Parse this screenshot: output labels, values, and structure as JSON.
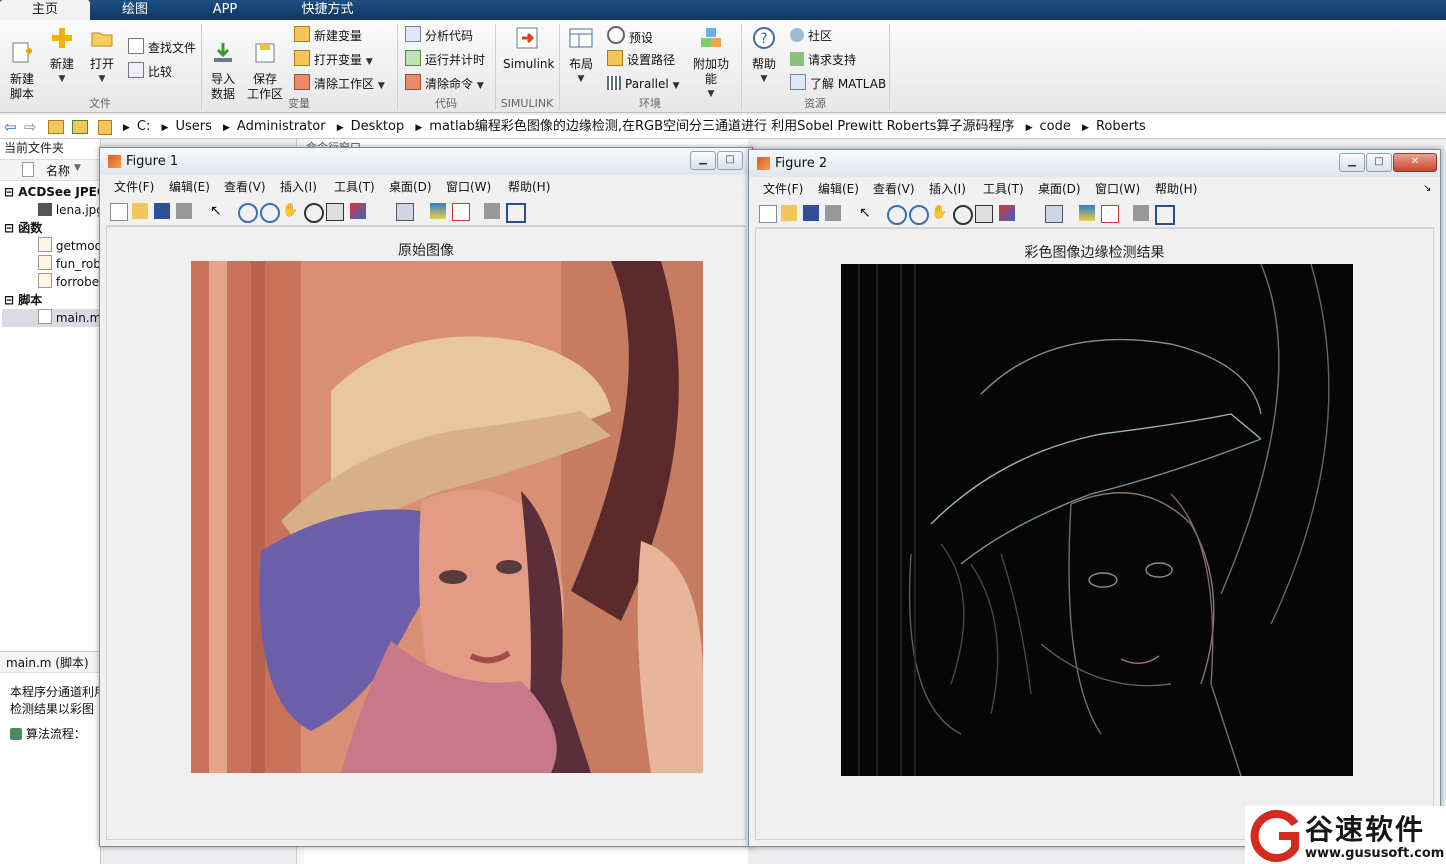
{
  "tabs": [
    {
      "label": "主页"
    },
    {
      "label": "绘图"
    },
    {
      "label": "APP"
    },
    {
      "label": "快捷方式"
    }
  ],
  "ribbon": {
    "file": {
      "new_script": "新建\n脚本",
      "new": "新建",
      "open": "打开",
      "find_files": "查找文件",
      "compare": "比较",
      "group": "文件"
    },
    "variable": {
      "import": "导入\n数据",
      "save_ws": "保存\n工作区",
      "new_var": "新建变量",
      "open_var": "打开变量",
      "clear_ws": "清除工作区",
      "group": "变量"
    },
    "code": {
      "analyze": "分析代码",
      "run_time": "运行并计时",
      "clear_cmd": "清除命令",
      "group": "代码"
    },
    "simulink": {
      "label": "Simulink",
      "group": "SIMULINK"
    },
    "env": {
      "layout": "布局",
      "prefs": "预设",
      "set_path": "设置路径",
      "parallel": "Parallel",
      "addons": "附加功能",
      "group": "环境"
    },
    "resources": {
      "help": "帮助",
      "community": "社区",
      "support": "请求支持",
      "learn": "了解 MATLAB",
      "group": "资源"
    }
  },
  "address": {
    "crumbs": [
      "C:",
      "Users",
      "Administrator",
      "Desktop",
      "matlab编程彩色图像的边缘检测,在RGB空间分三通道进行 利用Sobel Prewitt  Roberts算子源码程序",
      "code",
      "Roberts"
    ]
  },
  "left_panel": {
    "title": "当前文件夹",
    "name_col": "名称",
    "items": [
      {
        "label": "ACDSee JPEG",
        "kind": "group"
      },
      {
        "label": "lena.jpg",
        "kind": "file"
      },
      {
        "label": "函数",
        "kind": "group"
      },
      {
        "label": "getmod",
        "kind": "file"
      },
      {
        "label": "fun_rob",
        "kind": "file"
      },
      {
        "label": "forrobe",
        "kind": "file"
      },
      {
        "label": "脚本",
        "kind": "group"
      },
      {
        "label": "main.m",
        "kind": "file"
      }
    ],
    "detail_title": "main.m  (脚本)",
    "detail_line1": "本程序分通道利用",
    "detail_line2": "检测结果以彩图",
    "detail_line3": "算法流程：",
    "cmd_title": "命令行窗口"
  },
  "menus": [
    "文件(F)",
    "编辑(E)",
    "查看(V)",
    "插入(I)",
    "工具(T)",
    "桌面(D)",
    "窗口(W)",
    "帮助(H)"
  ],
  "figure1": {
    "title": "Figure 1",
    "plot_title": "原始图像"
  },
  "figure2": {
    "title": "Figure 2",
    "plot_title": "彩色图像边缘检测结果"
  },
  "watermark": {
    "brand": "谷速软件",
    "url": "www.gususoft.com"
  }
}
